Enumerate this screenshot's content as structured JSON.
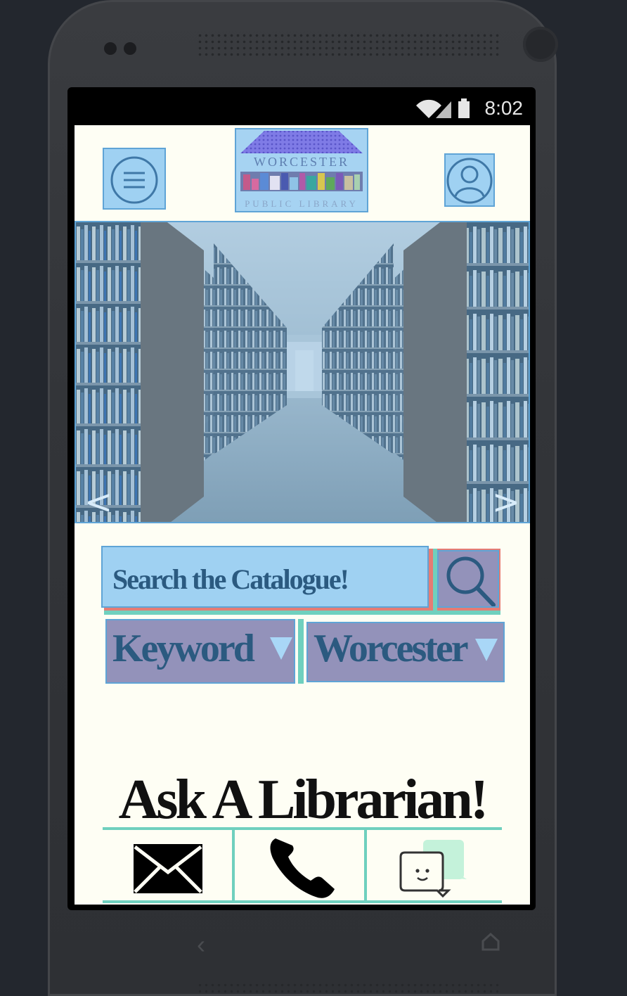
{
  "status_bar": {
    "time": "8:02"
  },
  "header": {
    "menu_icon": "hamburger-menu-icon",
    "logo": {
      "line1": "WORCESTER",
      "line2": "PUBLIC LIBRARY"
    },
    "profile_icon": "user-profile-icon"
  },
  "banner": {
    "prev_label": "<",
    "next_label": ">"
  },
  "search": {
    "placeholder": "Search the Catalogue!",
    "button_icon": "magnifier-icon",
    "type_selected": "Keyword",
    "location_selected": "Worcester"
  },
  "ask": {
    "title": "Ask A Librarian!",
    "options": [
      "email-icon",
      "phone-icon",
      "chat-icon"
    ]
  },
  "colors": {
    "app_bg": "#fefef4",
    "accent_blue": "#9fd1f2",
    "accent_purple": "#9392ba",
    "accent_teal": "#6fd0be",
    "accent_red": "#e57c74"
  }
}
